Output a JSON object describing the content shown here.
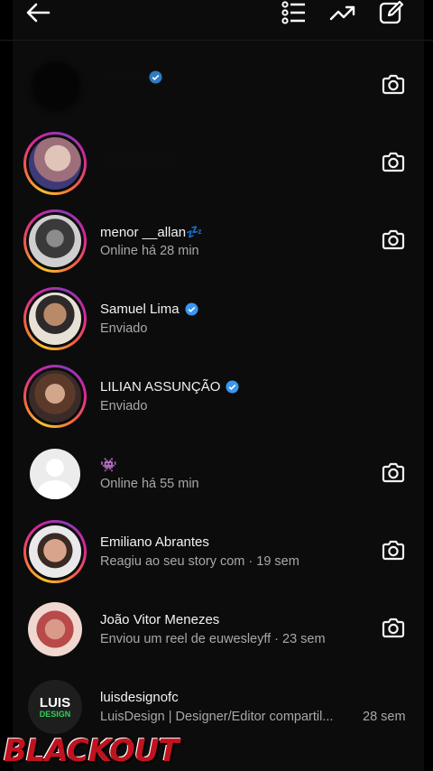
{
  "header": {
    "icons": [
      "back-arrow-icon",
      "list-icon",
      "trending-icon",
      "edit-icon"
    ]
  },
  "conversations": [
    {
      "name": "",
      "status": "",
      "verified": true,
      "camera": true,
      "ring": false
    },
    {
      "name": "",
      "status": "",
      "verified": false,
      "camera": true,
      "ring": true
    },
    {
      "name": "menor __allan💤",
      "status": "Online há 28 min",
      "verified": false,
      "camera": true,
      "ring": true
    },
    {
      "name": "Samuel Lima",
      "status": "Enviado",
      "verified": true,
      "camera": false,
      "ring": true
    },
    {
      "name": "LILIAN ASSUNÇÃO",
      "status": "Enviado",
      "verified": true,
      "camera": false,
      "ring": true
    },
    {
      "name": "👾",
      "status": "Online há 55 min",
      "verified": false,
      "camera": true,
      "ring": false
    },
    {
      "name": "Emiliano Abrantes",
      "status": "Reagiu ao seu story com · 19 sem",
      "verified": false,
      "camera": true,
      "ring": true
    },
    {
      "name": "João Vitor Menezes",
      "status": "Enviou um reel de euwesleyff · 23 sem",
      "verified": false,
      "camera": true,
      "ring": false
    },
    {
      "name": "luisdesignofc",
      "status": "LuisDesign | Designer/Editor compartil...",
      "time": "28 sem",
      "verified": false,
      "camera": false,
      "ring": false
    }
  ],
  "avatar_logo": {
    "line1": "LUIS",
    "line2": "DESIGN"
  },
  "watermark": "BLACKOUT",
  "colors": {
    "background": "#0c0c0c",
    "secondary_text": "#a8a8a8",
    "verified_blue": "#3897f0"
  }
}
